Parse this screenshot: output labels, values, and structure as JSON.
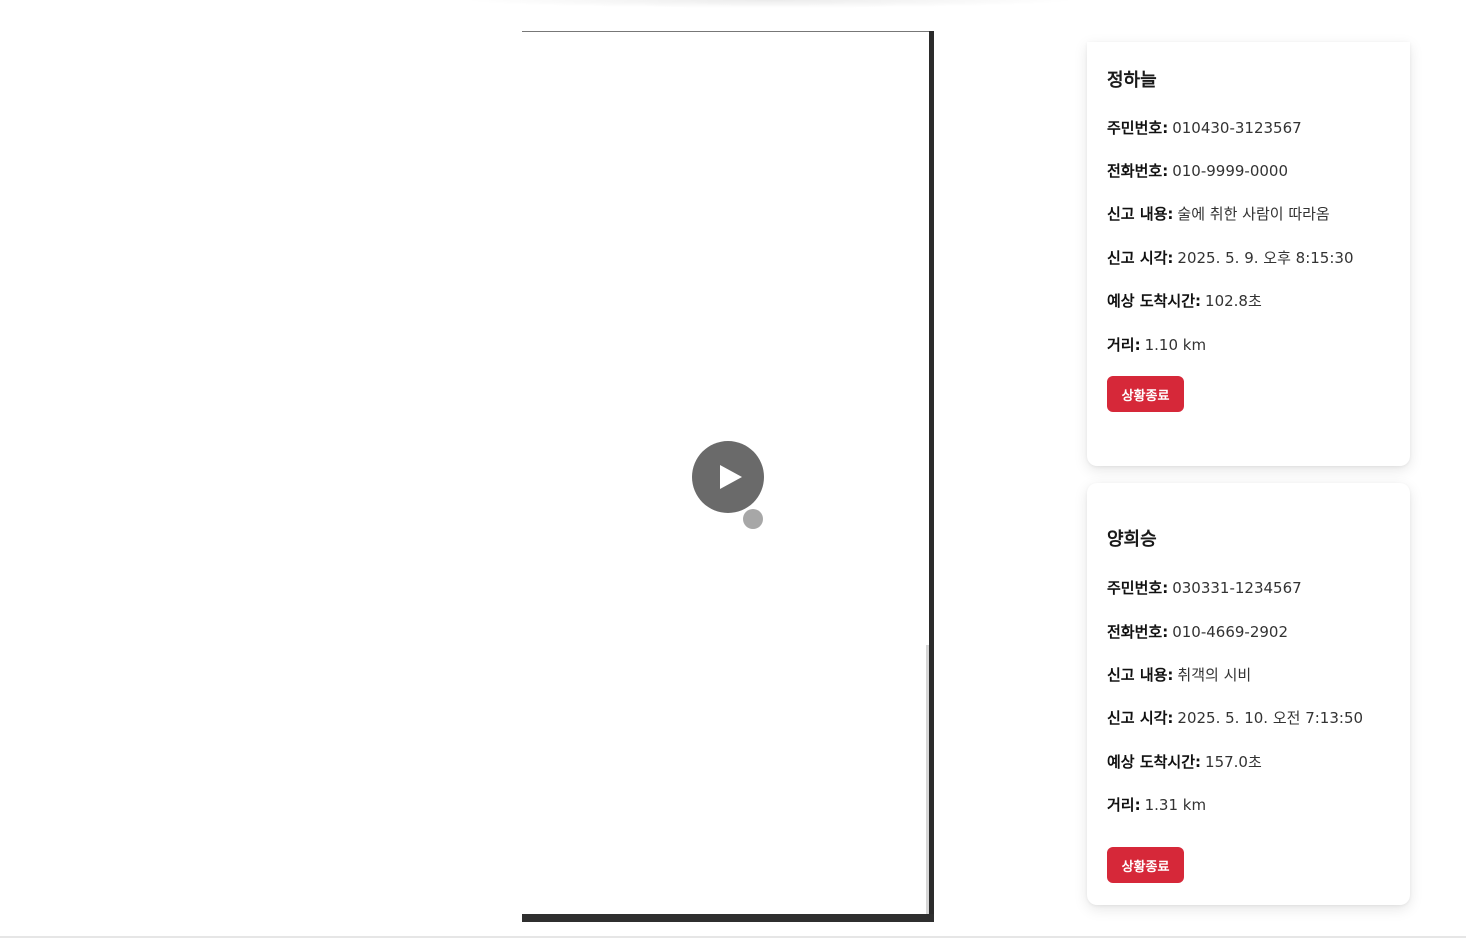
{
  "cards": [
    {
      "name": "정하늘",
      "rrn_label": "주민번호:",
      "rrn": "010430-3123567",
      "phone_label": "전화번호:",
      "phone": "010-9999-0000",
      "content_label": "신고 내용:",
      "content": "술에 취한 사람이 따라옴",
      "time_label": "신고 시각:",
      "time": "2025. 5. 9. 오후 8:15:30",
      "eta_label": "예상 도착시간:",
      "eta": "102.8초",
      "distance_label": "거리:",
      "distance": "1.10 km",
      "button_label": "상황종료"
    },
    {
      "name": "양희승",
      "rrn_label": "주민번호:",
      "rrn": "030331-1234567",
      "phone_label": "전화번호:",
      "phone": "010-4669-2902",
      "content_label": "신고 내용:",
      "content": "취객의 시비",
      "time_label": "신고 시각:",
      "time": "2025. 5. 10. 오전 7:13:50",
      "eta_label": "예상 도착시간:",
      "eta": "157.0초",
      "distance_label": "거리:",
      "distance": "1.31 km",
      "button_label": "상황종료"
    }
  ],
  "icons": {
    "play": "play-icon"
  },
  "colors": {
    "button_bg": "#d62839",
    "button_text": "#ffffff",
    "play_overlay": "#505050"
  }
}
